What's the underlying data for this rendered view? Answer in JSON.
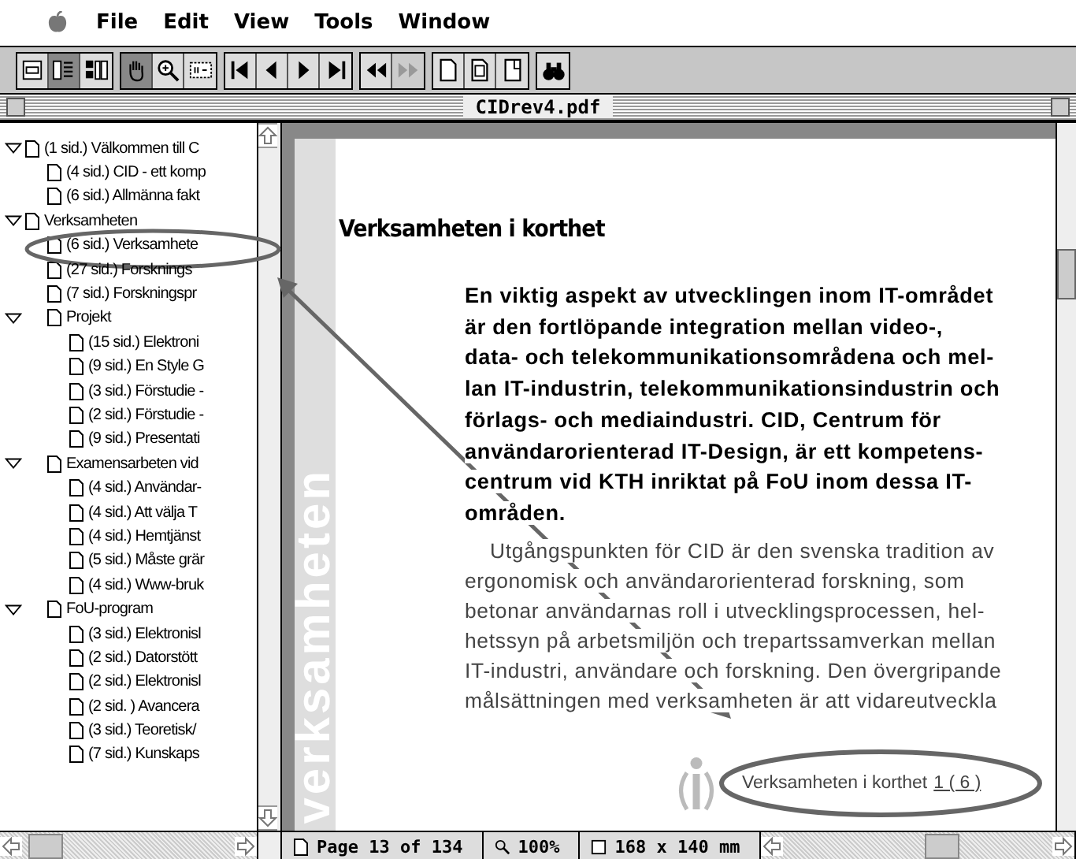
{
  "menu": [
    "File",
    "Edit",
    "View",
    "Tools",
    "Window"
  ],
  "toolbar": [
    [
      {
        "kind": "page-only",
        "pressed": false,
        "disabled": false
      },
      {
        "kind": "bookmarks",
        "pressed": true,
        "disabled": false
      },
      {
        "kind": "thumbnails",
        "pressed": false,
        "disabled": false
      }
    ],
    [
      {
        "kind": "hand",
        "pressed": true,
        "disabled": false
      },
      {
        "kind": "zoom",
        "pressed": false,
        "disabled": false
      },
      {
        "kind": "text-select",
        "pressed": false,
        "disabled": false
      }
    ],
    [
      {
        "kind": "first",
        "pressed": false,
        "disabled": false
      },
      {
        "kind": "prev",
        "pressed": false,
        "disabled": false
      },
      {
        "kind": "next",
        "pressed": false,
        "disabled": false
      },
      {
        "kind": "last",
        "pressed": false,
        "disabled": false
      }
    ],
    [
      {
        "kind": "back",
        "pressed": false,
        "disabled": false
      },
      {
        "kind": "forward",
        "pressed": false,
        "disabled": true
      }
    ],
    [
      {
        "kind": "single-page",
        "pressed": false,
        "disabled": false
      },
      {
        "kind": "continuous",
        "pressed": false,
        "disabled": false
      },
      {
        "kind": "facing",
        "pressed": false,
        "disabled": false
      }
    ],
    [
      {
        "kind": "find",
        "pressed": false,
        "disabled": false
      }
    ]
  ],
  "window": {
    "title": "CIDrev4.pdf"
  },
  "bookmarks": [
    {
      "label": "(1 sid.) Välkommen till C",
      "expanded": true,
      "children": [
        {
          "label": "(4 sid.) CID - ett komp"
        },
        {
          "label": "(6 sid.) Allmänna fakt"
        }
      ]
    },
    {
      "label": "Verksamheten",
      "expanded": true,
      "children": [
        {
          "label": "(6 sid.) Verksamhete"
        },
        {
          "label": "(27 sid.) Forsknings"
        },
        {
          "label": "(7 sid.) Forskningspr"
        },
        {
          "label": "Projekt",
          "expanded": true,
          "children": [
            {
              "label": "(15 sid.) Elektroni"
            },
            {
              "label": "(9 sid.) En Style G"
            },
            {
              "label": "(3 sid.) Förstudie -"
            },
            {
              "label": "(2 sid.) Förstudie -"
            },
            {
              "label": "(9 sid.) Presentati"
            }
          ]
        },
        {
          "label": "Examensarbeten vid",
          "expanded": true,
          "children": [
            {
              "label": "(4 sid.) Användar-"
            },
            {
              "label": "(4 sid.) Att välja T"
            },
            {
              "label": "(4 sid.) Hemtjänst"
            },
            {
              "label": "(5 sid.) Måste grär"
            },
            {
              "label": "(4 sid.) Www-bruk"
            }
          ]
        },
        {
          "label": "FoU-program",
          "expanded": true,
          "children": [
            {
              "label": "(3 sid.) Elektronisl"
            },
            {
              "label": "(2 sid.) Datorstött"
            },
            {
              "label": "(2 sid.) Elektronisl"
            },
            {
              "label": "(2 sid. ) Avancera"
            },
            {
              "label": "(3 sid.) Teoretisk/"
            },
            {
              "label": "(7 sid.) Kunskaps"
            }
          ]
        }
      ]
    }
  ],
  "page": {
    "side_label": "verksamheten",
    "heading": "Verksamheten i korthet",
    "lead_lines": [
      "En viktig aspekt av utvecklingen inom IT-området",
      "är den fortlöpande integration mellan video-,",
      "data- och telekommunikationsområdena och mel-",
      "lan IT-industrin, telekommunikationsindustrin och",
      "förlags- och mediaindustri. CID, Centrum för",
      "användarorienterad IT-Design, är ett kompetens-",
      "centrum vid KTH inriktat på FoU inom dessa IT-",
      "områden."
    ],
    "body_lines": [
      "Utgångspunkten för CID är den svenska tradition av",
      "ergonomisk och användarorienterad forskning, som",
      "betonar användarnas roll i utvecklingsprocessen, hel-",
      "hetssyn på arbetsmiljön och trepartssamverkan mellan",
      "IT-industri, användare och forskning. Den övergripande",
      "målsättningen med verksamheten är att vidareutveckla"
    ],
    "footer_title": "Verksamheten i korthet",
    "footer_page": "1 ( 6 )"
  },
  "status_bar": {
    "page": "Page 13 of 134",
    "zoom": "100%",
    "size": "168 x 140 mm"
  }
}
